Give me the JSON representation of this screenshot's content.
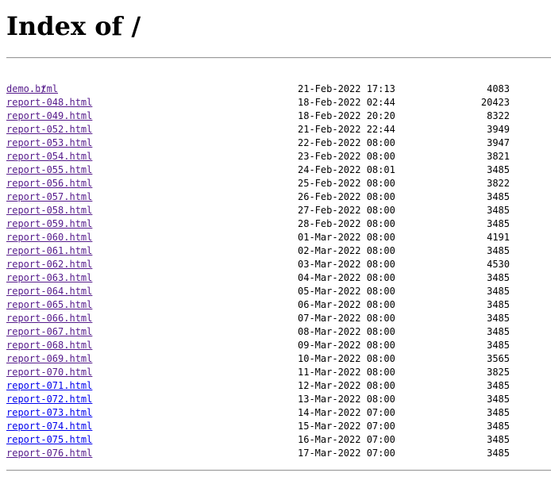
{
  "page": {
    "title": "Index of /",
    "parent_link": "../"
  },
  "files": [
    {
      "name": "demo.html",
      "date": "21-Feb-2022 17:13",
      "size": "4083",
      "visited": true
    },
    {
      "name": "report-048.html",
      "date": "18-Feb-2022 02:44",
      "size": "20423",
      "visited": true
    },
    {
      "name": "report-049.html",
      "date": "18-Feb-2022 20:20",
      "size": "8322",
      "visited": true
    },
    {
      "name": "report-052.html",
      "date": "21-Feb-2022 22:44",
      "size": "3949",
      "visited": true
    },
    {
      "name": "report-053.html",
      "date": "22-Feb-2022 08:00",
      "size": "3947",
      "visited": true
    },
    {
      "name": "report-054.html",
      "date": "23-Feb-2022 08:00",
      "size": "3821",
      "visited": true
    },
    {
      "name": "report-055.html",
      "date": "24-Feb-2022 08:01",
      "size": "3485",
      "visited": true
    },
    {
      "name": "report-056.html",
      "date": "25-Feb-2022 08:00",
      "size": "3822",
      "visited": true
    },
    {
      "name": "report-057.html",
      "date": "26-Feb-2022 08:00",
      "size": "3485",
      "visited": true
    },
    {
      "name": "report-058.html",
      "date": "27-Feb-2022 08:00",
      "size": "3485",
      "visited": true
    },
    {
      "name": "report-059.html",
      "date": "28-Feb-2022 08:00",
      "size": "3485",
      "visited": true
    },
    {
      "name": "report-060.html",
      "date": "01-Mar-2022 08:00",
      "size": "4191",
      "visited": true
    },
    {
      "name": "report-061.html",
      "date": "02-Mar-2022 08:00",
      "size": "3485",
      "visited": true
    },
    {
      "name": "report-062.html",
      "date": "03-Mar-2022 08:00",
      "size": "4530",
      "visited": true
    },
    {
      "name": "report-063.html",
      "date": "04-Mar-2022 08:00",
      "size": "3485",
      "visited": true
    },
    {
      "name": "report-064.html",
      "date": "05-Mar-2022 08:00",
      "size": "3485",
      "visited": true
    },
    {
      "name": "report-065.html",
      "date": "06-Mar-2022 08:00",
      "size": "3485",
      "visited": true
    },
    {
      "name": "report-066.html",
      "date": "07-Mar-2022 08:00",
      "size": "3485",
      "visited": true
    },
    {
      "name": "report-067.html",
      "date": "08-Mar-2022 08:00",
      "size": "3485",
      "visited": true
    },
    {
      "name": "report-068.html",
      "date": "09-Mar-2022 08:00",
      "size": "3485",
      "visited": true
    },
    {
      "name": "report-069.html",
      "date": "10-Mar-2022 08:00",
      "size": "3565",
      "visited": true
    },
    {
      "name": "report-070.html",
      "date": "11-Mar-2022 08:00",
      "size": "3825",
      "visited": true
    },
    {
      "name": "report-071.html",
      "date": "12-Mar-2022 08:00",
      "size": "3485",
      "visited": false
    },
    {
      "name": "report-072.html",
      "date": "13-Mar-2022 08:00",
      "size": "3485",
      "visited": false
    },
    {
      "name": "report-073.html",
      "date": "14-Mar-2022 07:00",
      "size": "3485",
      "visited": false
    },
    {
      "name": "report-074.html",
      "date": "15-Mar-2022 07:00",
      "size": "3485",
      "visited": false
    },
    {
      "name": "report-075.html",
      "date": "16-Mar-2022 07:00",
      "size": "3485",
      "visited": false
    },
    {
      "name": "report-076.html",
      "date": "17-Mar-2022 07:00",
      "size": "3485",
      "visited": true
    }
  ],
  "colors": {
    "link_visited": "#551a8b",
    "link_unvisited": "#0000ee"
  }
}
